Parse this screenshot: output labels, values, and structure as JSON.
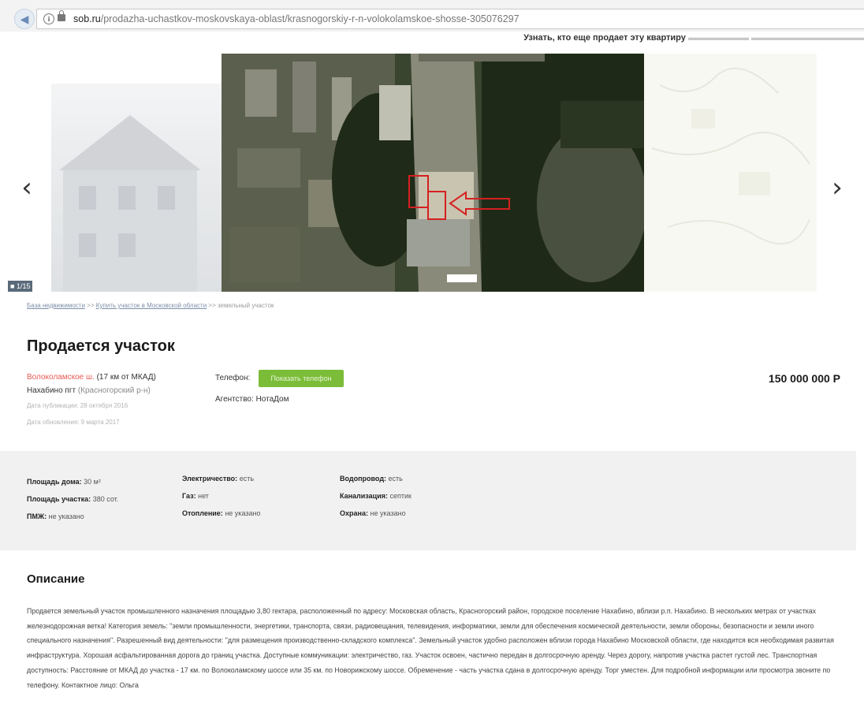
{
  "browser": {
    "url_host": "sob.ru",
    "url_path": "/prodazha-uchastkov-moskovskaya-oblast/krasnogorskiy-r-n-volokolamskoe-shosse-305076297"
  },
  "topstrip": {
    "text": "Узнать, кто еще продает эту квартиру"
  },
  "gallery": {
    "prev_glyph": "‹",
    "next_glyph": "›",
    "counter": "1/15"
  },
  "breadcrumb": {
    "link1": "База недвижимости",
    "sep1": ">>",
    "link2": "Купить участок в Московской области",
    "sep2": ">>",
    "current": "земельный участок"
  },
  "listing": {
    "title": "Продается участок",
    "street": "Волоколамское ш.",
    "distance": "(17 км от МКАД)",
    "town": "Нахабино пгт",
    "district": "(Красногорский р-н)",
    "published": "Дата публикации: 28 октября 2016",
    "updated": "Дата обновления: 9 марта 2017",
    "phone_label": "Телефон:",
    "phone_button": "Показать телефон",
    "agency_label": "Агентство:",
    "agency_value": "НотаДом",
    "price": "150 000 000 Р"
  },
  "params": {
    "house_area_label": "Площадь дома:",
    "house_area_value": "30 м²",
    "plot_area_label": "Площадь участка:",
    "plot_area_value": "380 сот.",
    "pmzh_label": "ПМЖ:",
    "pmzh_value": "не указано",
    "electricity_label": "Электричество:",
    "electricity_value": "есть",
    "gas_label": "Газ:",
    "gas_value": "нет",
    "heating_label": "Отопление:",
    "heating_value": "не указано",
    "water_label": "Водопровод:",
    "water_value": "есть",
    "sewer_label": "Канализация:",
    "sewer_value": "септик",
    "security_label": "Охрана:",
    "security_value": "не указано"
  },
  "description": {
    "title": "Описание",
    "text": "Продается земельный участок промышленного назначения площадью 3,80 гектара, расположенный по адресу: Московская область, Красногорский район, городское поселение Нахабино, вблизи р.п. Нахабино. В нескольких метрах от участках железнодорожная ветка! Категория земель: \"земли промышленности, энергетики, транспорта, связи, радиовещания, телевидения, информатики, земли для обеспечения космической деятельности, земли обороны, безопасности и земли иного специального назначения\". Разрешенный вид деятельности: \"для размещения производственно-складского комплекса\". Земельный участок удобно расположен вблизи города Нахабино Московской области, где находится вся необходимая развитая инфраструктура. Хорошая асфальтированная дорога до границ участка. Доступные коммуникации: электричество, газ. Участок освоен, частично передан в долгосрочную аренду. Через дорогу, напротив участка растет густой лес. Транспортная доступность: Расстояние от МКАД до участка - 17 км. по Волоколамскому шоссе или 35 км. по Новорижскому шоссе. Обременение - часть участка сдана в долгосрочную аренду. Торг уместен. Для подробной информации или просмотра звоните по телефону. Контактное лицо: Ольга"
  },
  "colors": {
    "accent_green": "#7bbd38",
    "address_red": "#e85a55",
    "marker_red": "#d62020"
  }
}
